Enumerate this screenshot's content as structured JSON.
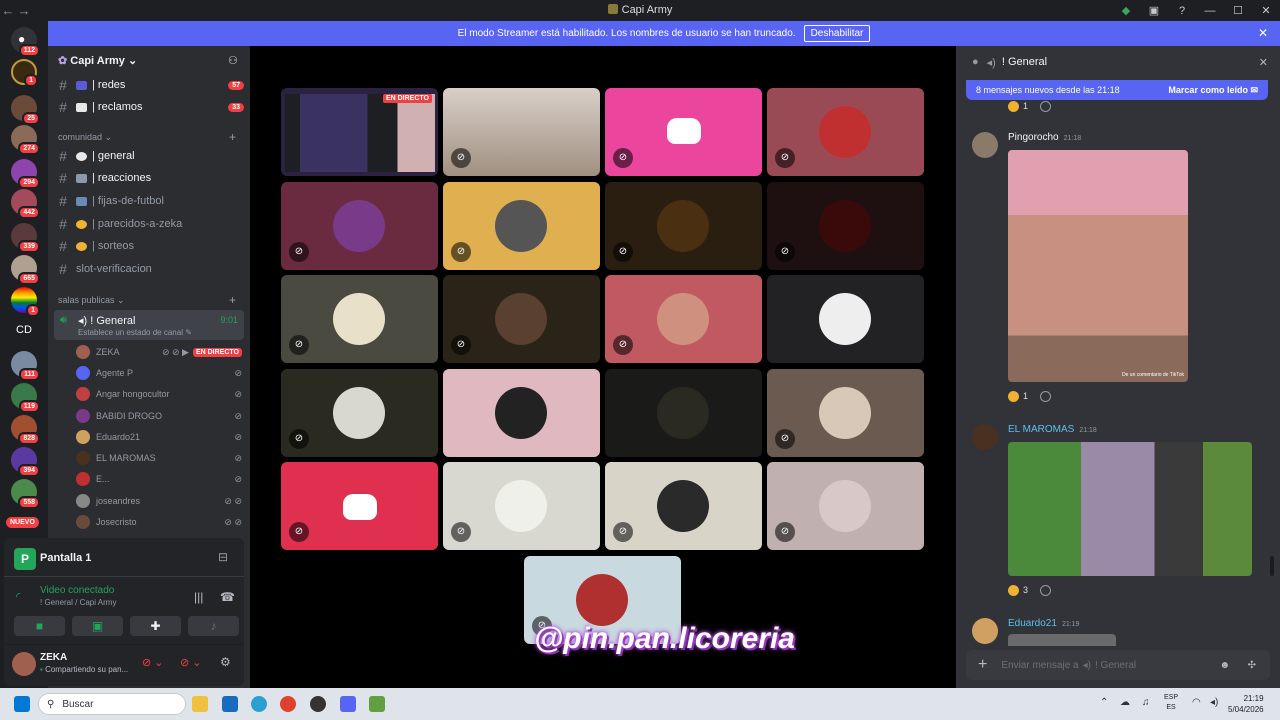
{
  "window": {
    "title": "Capi Army"
  },
  "banner": {
    "text": "El modo Streamer está habilitado. Los nombres de usuario se han truncado.",
    "button": "Deshabilitar"
  },
  "servers": {
    "badges": [
      "112",
      "1",
      "25",
      "274",
      "294",
      "442",
      "339",
      "665",
      "1",
      "111",
      "119",
      "828",
      "394",
      "558"
    ],
    "cd_label": "CD",
    "new_label": "NUEVO"
  },
  "sidebar": {
    "server_name": "Capi Army",
    "top_channels": [
      {
        "name": "| redes",
        "badge": "57"
      },
      {
        "name": "| reclamos",
        "badge": "33"
      }
    ],
    "category_comunidad": "comunidad",
    "channels": [
      {
        "name": "| general"
      },
      {
        "name": "| reacciones"
      },
      {
        "name": "| fijas-de-futbol"
      },
      {
        "name": "| parecidos-a-zeka"
      },
      {
        "name": "| sorteos"
      },
      {
        "name": "slot-verificacion"
      }
    ],
    "category_salas": "salas publicas",
    "voice_channel": {
      "name": "ǃ General",
      "time": "9:01",
      "status": "Establece un estado de canal"
    },
    "members": [
      {
        "name": "ZEKA",
        "live": "EN DIRECTO"
      },
      {
        "name": "Agente P"
      },
      {
        "name": "Angar hongocultor"
      },
      {
        "name": "BABIDI DROGO"
      },
      {
        "name": "Eduardo21"
      },
      {
        "name": "EL MAROMAS"
      },
      {
        "name": "E..."
      },
      {
        "name": "joseandres"
      },
      {
        "name": "Josecristo"
      }
    ]
  },
  "userpanel": {
    "screen_title": "Pantalla 1",
    "video_status": "Video conectado",
    "video_location": "ǃ General / Capi Army",
    "user_name": "ZEKA",
    "user_status": "Compartiendo su pan..."
  },
  "stage": {
    "live_label": "EN DIRECTO",
    "watermark": "@pin.pan.licoreria"
  },
  "chat": {
    "channel": "ǃ General",
    "new_messages": "8 mensajes nuevos desde las 21:18",
    "mark_read": "Marcar como leído",
    "messages": [
      {
        "author": "Pingorocho",
        "time": "21:18",
        "reaction_count": "1",
        "img_caption": "De un comentario de TikTok"
      },
      {
        "author": "EL MAROMAS",
        "time": "21:18",
        "reaction_count": "3"
      },
      {
        "author": "Eduardo21",
        "time": "21:19"
      }
    ],
    "top_reaction_count": "1",
    "input_placeholder": "Enviar mensaje a",
    "input_channel": "ǃ General"
  },
  "taskbar": {
    "search": "Buscar",
    "lang_top": "ESP",
    "lang_bottom": "ES",
    "time": "21:19",
    "date": "5/04/2026"
  }
}
